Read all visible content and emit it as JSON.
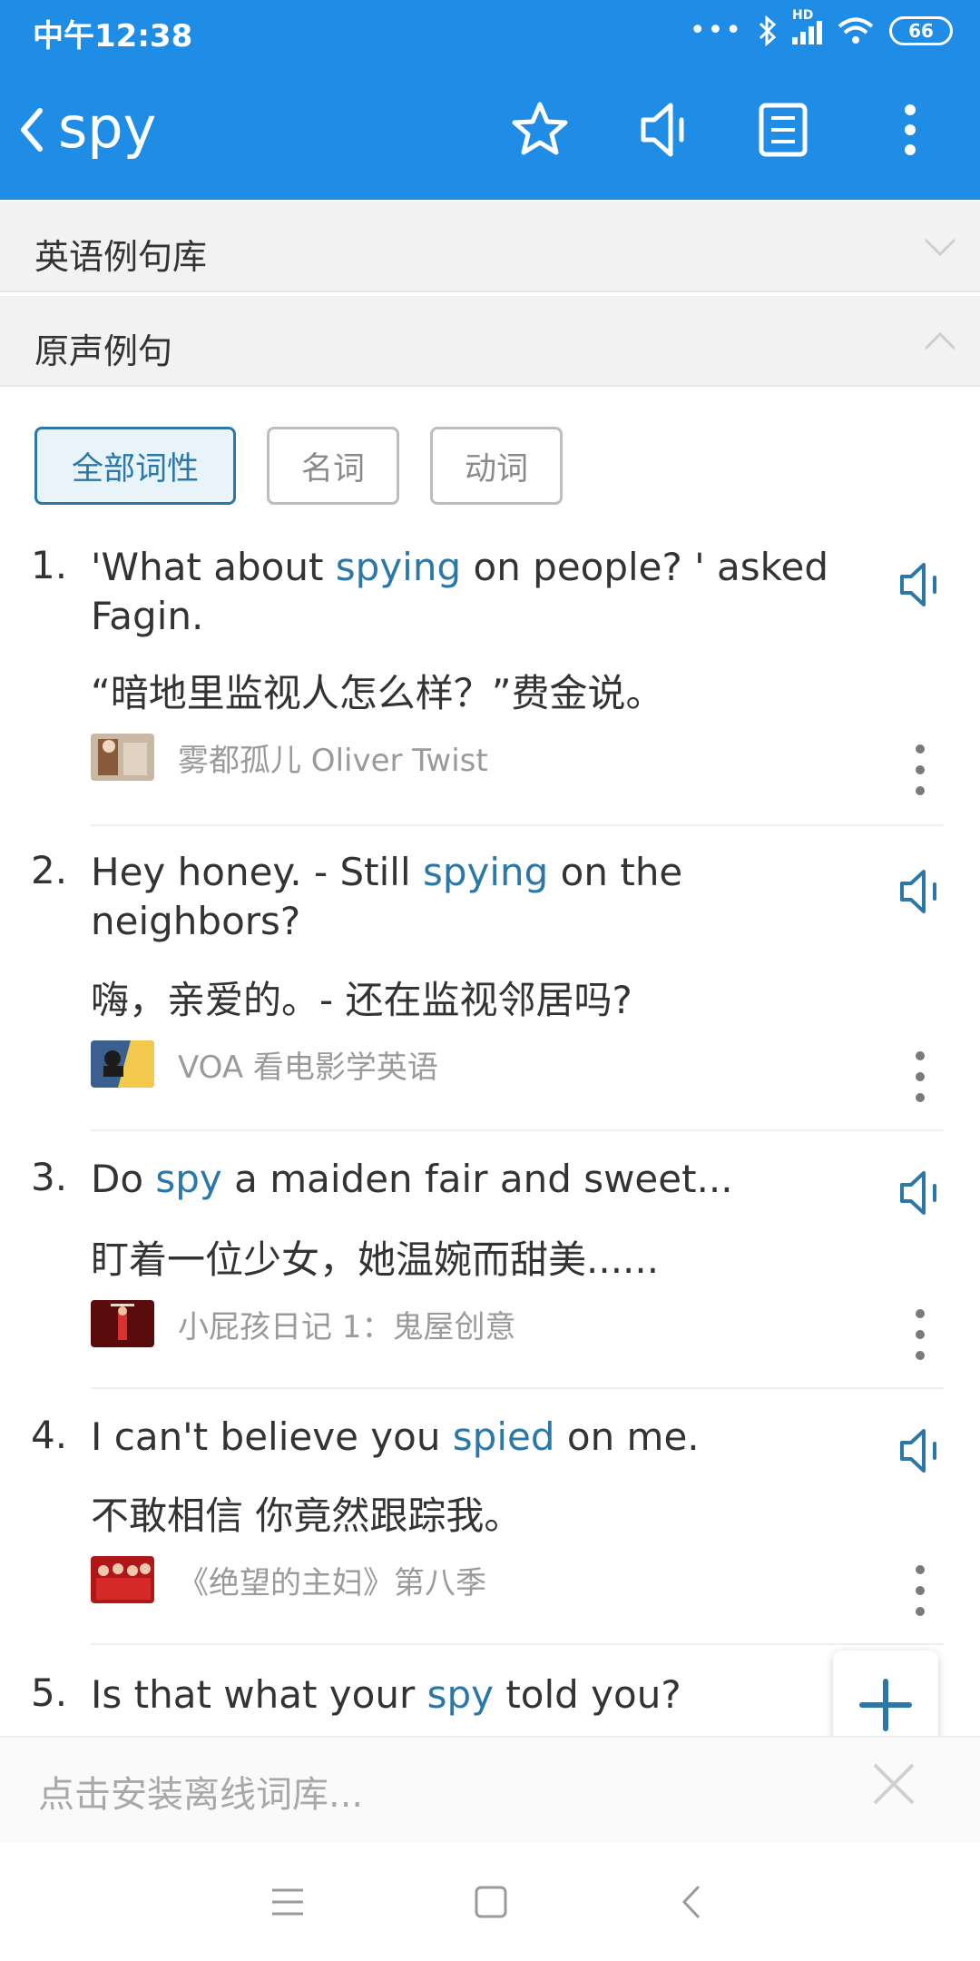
{
  "status_bar": {
    "time": "中午12:38",
    "dots": "•••",
    "network_label": "HD",
    "battery": "66"
  },
  "header": {
    "title": "spy"
  },
  "sections": [
    {
      "label": "英语例句库",
      "state": "collapsed"
    },
    {
      "label": "原声例句",
      "state": "expanded"
    }
  ],
  "filters": [
    {
      "label": "全部词性",
      "active": true
    },
    {
      "label": "名词",
      "active": false
    },
    {
      "label": "动词",
      "active": false
    }
  ],
  "examples": [
    {
      "num": "1.",
      "en_parts": [
        "'What about ",
        "spying",
        " on people? ' asked Fagin."
      ],
      "zh": "“暗地里监视人怎么样？”费金说。",
      "source": "雾都孤儿 Oliver Twist"
    },
    {
      "num": "2.",
      "en_parts": [
        "Hey honey. - Still ",
        "spying",
        " on the neighbors?"
      ],
      "zh": "嗨，亲爱的。- 还在监视邻居吗?",
      "source": "VOA 看电影学英语"
    },
    {
      "num": "3.",
      "en_parts": [
        "Do ",
        "spy",
        " a maiden fair and sweet..."
      ],
      "zh": "盯着一位少女，她温婉而甜美......",
      "source": "小屁孩日记 1：鬼屋创意"
    },
    {
      "num": "4.",
      "en_parts": [
        "I can't believe you ",
        "spied",
        " on me."
      ],
      "zh": "不敢相信 你竟然跟踪我。",
      "source": "《绝望的主妇》第八季"
    },
    {
      "num": "5.",
      "en_parts": [
        "Is that what your ",
        "spy",
        " told you?"
      ]
    }
  ],
  "install_bar": {
    "text": "点击安装离线词库..."
  },
  "colors": {
    "primary": "#1f8de6",
    "highlight": "#2b78a8",
    "muted": "#9a9a9a"
  }
}
